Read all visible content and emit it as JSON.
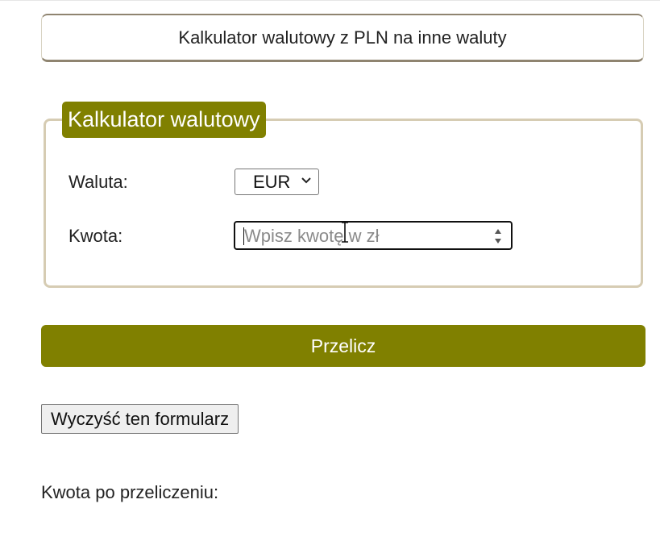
{
  "header": {
    "title": "Kalkulator walutowy z PLN na inne waluty"
  },
  "form": {
    "legend": "Kalkulator walutowy",
    "currency_label": "Waluta:",
    "currency_selected": "EUR",
    "amount_label": "Kwota:",
    "amount_placeholder": "Wpisz kwotę w zł",
    "amount_value": ""
  },
  "actions": {
    "convert_label": "Przelicz",
    "reset_label": "Wyczyść ten formularz"
  },
  "result": {
    "label": "Kwota po przeliczeniu:"
  },
  "colors": {
    "accent": "#808000",
    "fieldset_border": "#d6ccb3",
    "header_border": "#8f8470"
  },
  "icons": {
    "select_arrow": "chevron-down-icon",
    "spinner": "spinner-arrows-icon",
    "cursor": "text-cursor-icon"
  }
}
